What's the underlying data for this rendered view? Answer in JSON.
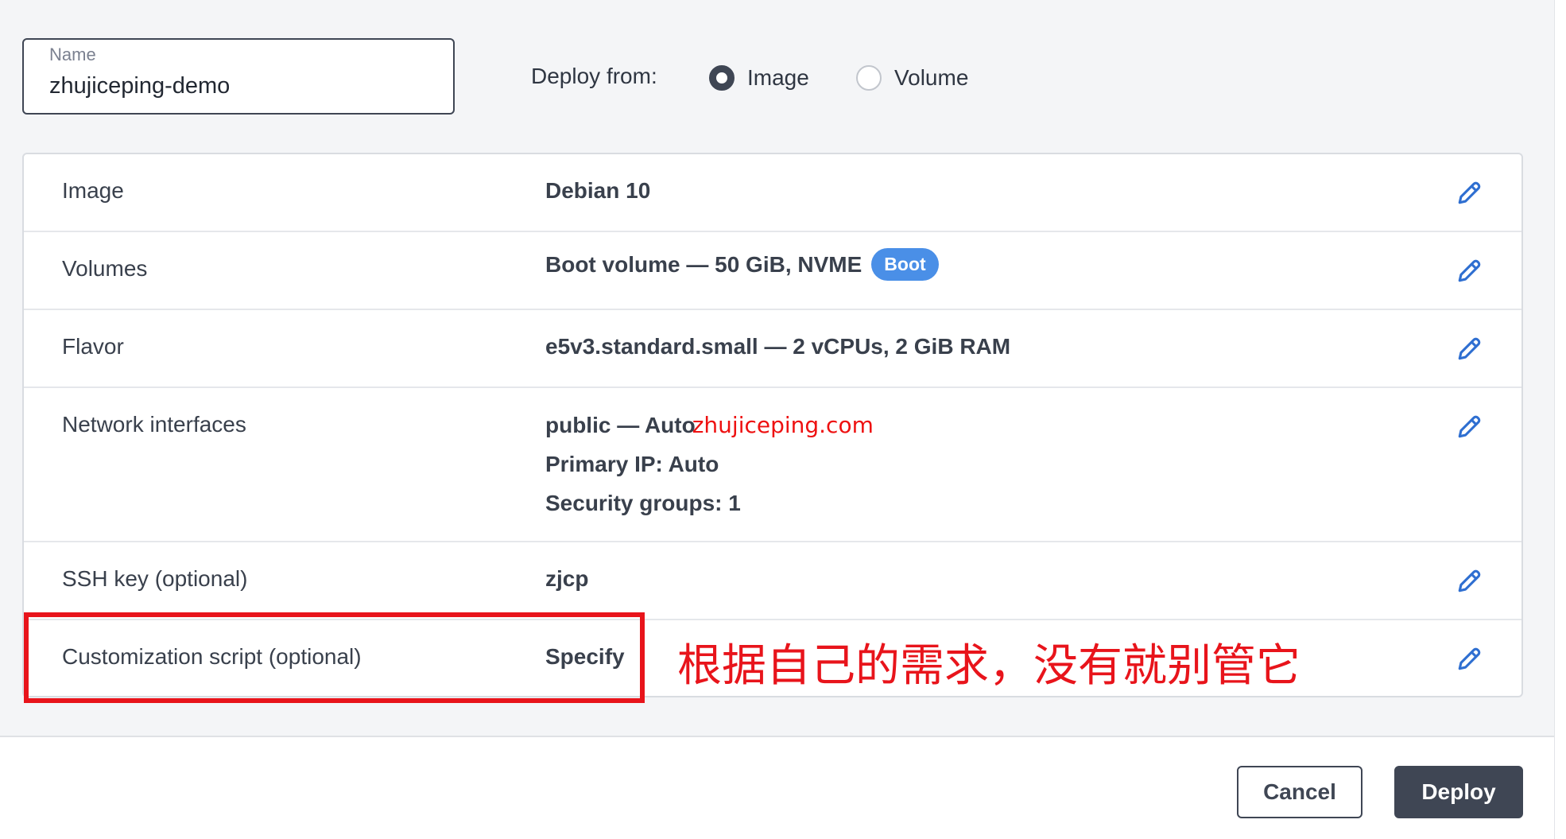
{
  "name_field": {
    "label": "Name",
    "value": "zhujiceping-demo"
  },
  "deploy_from": {
    "label": "Deploy from:",
    "options": [
      {
        "label": "Image",
        "selected": true
      },
      {
        "label": "Volume",
        "selected": false
      }
    ]
  },
  "rows": [
    {
      "key": "Image",
      "value": "Debian 10"
    },
    {
      "key": "Volumes",
      "value": "Boot volume  — 50 GiB, NVME",
      "badge": "Boot"
    },
    {
      "key": "Flavor",
      "value": "e5v3.standard.small  — 2 vCPUs, 2 GiB RAM"
    },
    {
      "key": "Network interfaces",
      "lines": [
        "public  — Auto",
        "Primary IP:  Auto",
        "Security groups:  1"
      ],
      "watermark": "zhujiceping.com"
    },
    {
      "key": "SSH key (optional)",
      "value": "zjcp"
    },
    {
      "key": "Customization script (optional)",
      "value": "Specify"
    }
  ],
  "annotation": "根据自己的需求，没有就别管它",
  "footer": {
    "cancel_label": "Cancel",
    "deploy_label": "Deploy"
  },
  "colors": {
    "primary_dark": "#3f4654",
    "link_blue": "#2f6fd1",
    "badge_blue": "#4a8fe7",
    "annotation_red": "#e8141b"
  },
  "icons": {
    "edit": "pencil-icon"
  }
}
